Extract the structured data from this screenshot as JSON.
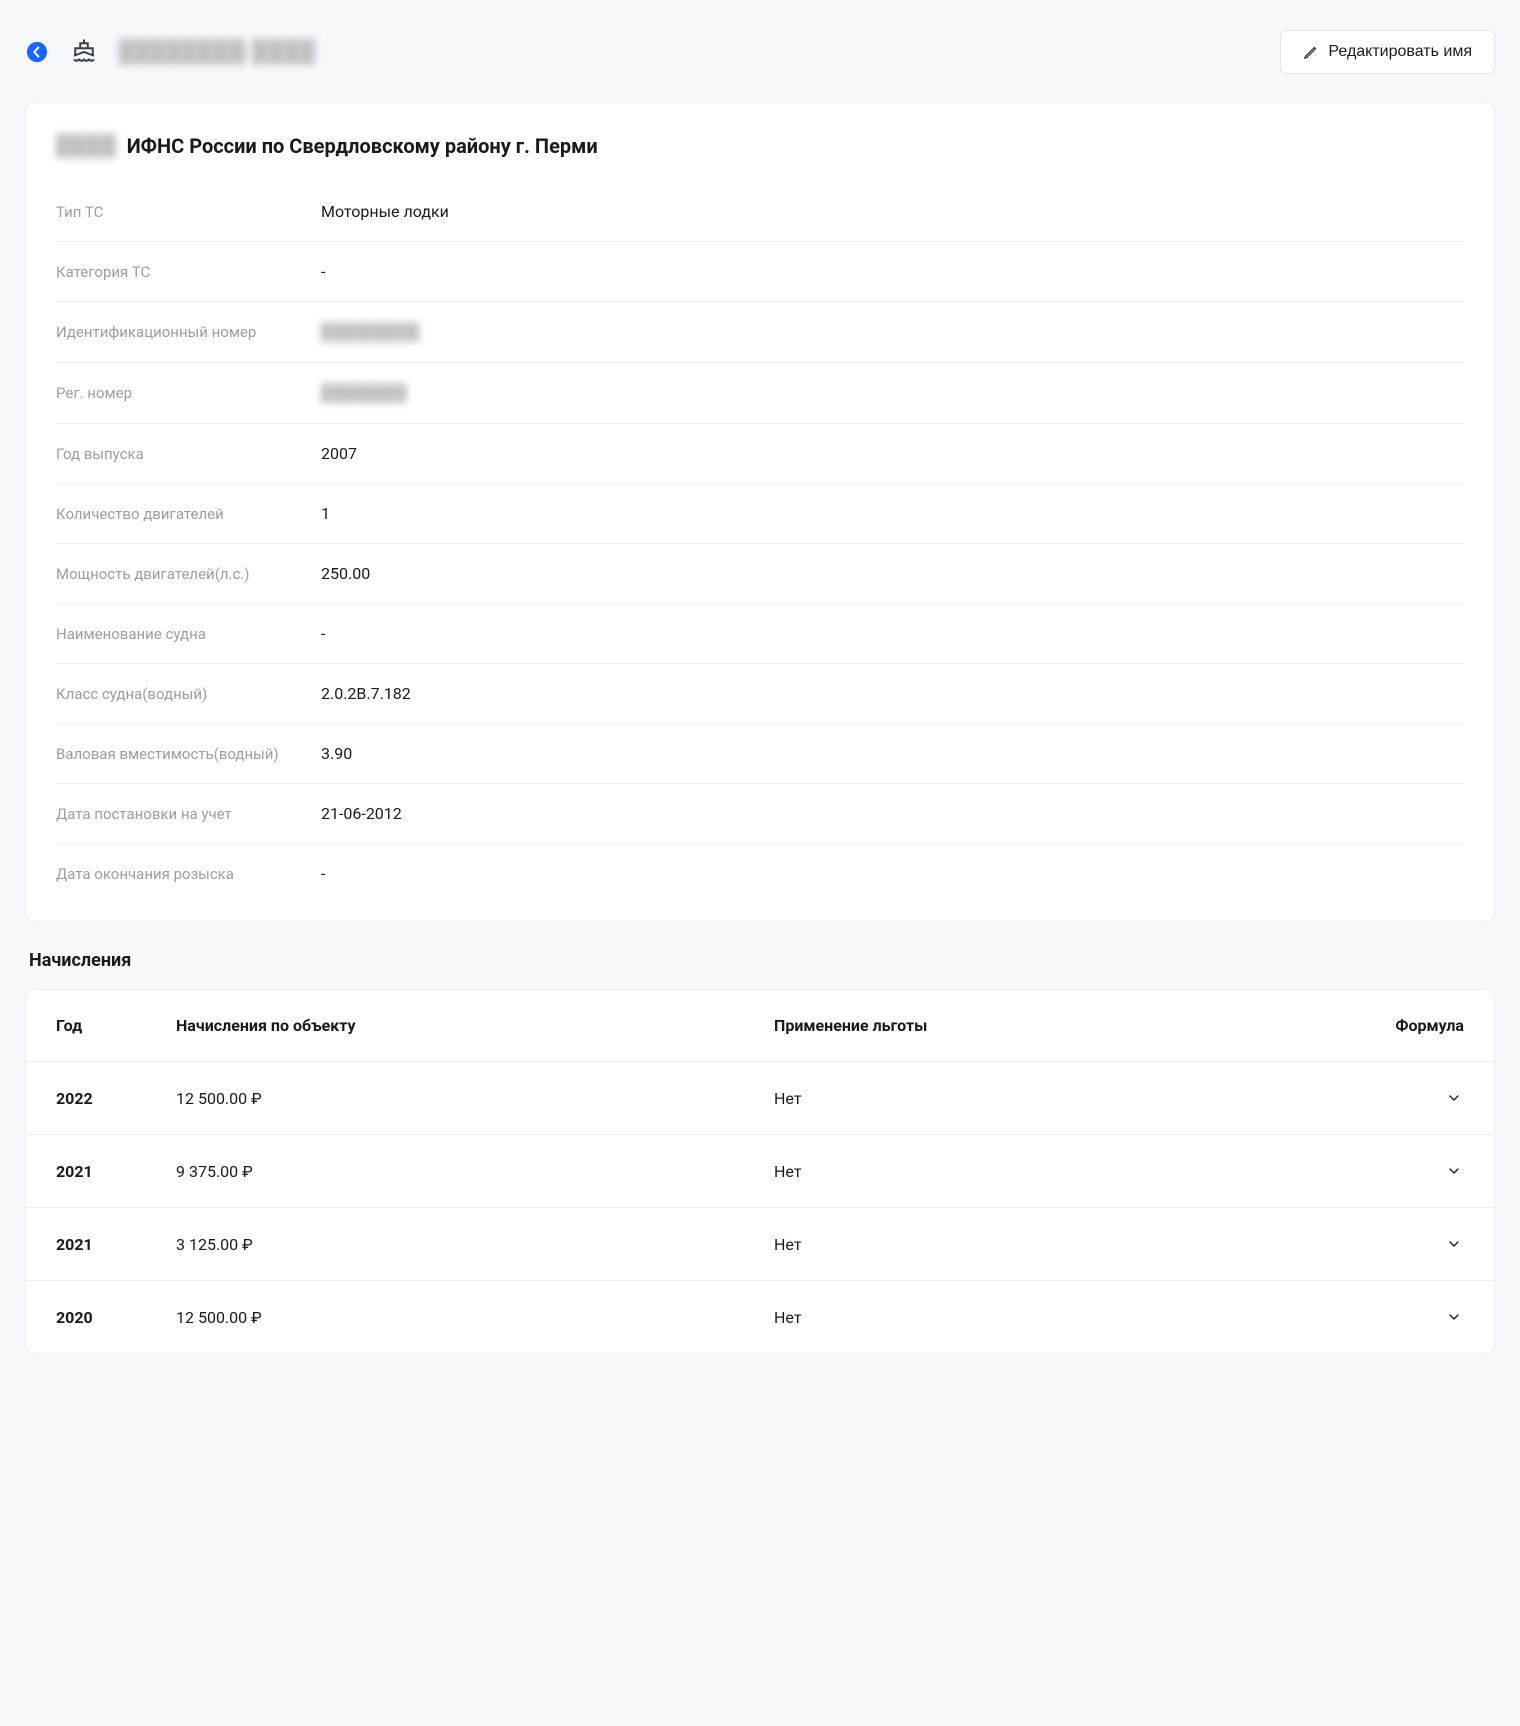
{
  "header": {
    "ship_title": "████████ ████",
    "edit_label": "Редактировать имя"
  },
  "card": {
    "id": "████",
    "title": "ИФНС России по Свердловскому району г. Перми"
  },
  "details": [
    {
      "label": "Тип ТС",
      "value": "Моторные лодки",
      "blurred": false
    },
    {
      "label": "Категория ТС",
      "value": "-",
      "blurred": false
    },
    {
      "label": "Идентификационный номер",
      "value": "████████",
      "blurred": true
    },
    {
      "label": "Рег. номер",
      "value": "███████",
      "blurred": true
    },
    {
      "label": "Год выпуска",
      "value": "2007",
      "blurred": false
    },
    {
      "label": "Количество двигателей",
      "value": "1",
      "blurred": false
    },
    {
      "label": "Мощность двигателей(л.с.)",
      "value": "250.00",
      "blurred": false
    },
    {
      "label": "Наименование судна",
      "value": "-",
      "blurred": false
    },
    {
      "label": "Класс судна(водный)",
      "value": "2.0.2В.7.182",
      "blurred": false
    },
    {
      "label": "Валовая вместимость(водный)",
      "value": "3.90",
      "blurred": false
    },
    {
      "label": "Дата постановки на учет",
      "value": "21-06-2012",
      "blurred": false
    },
    {
      "label": "Дата окончания розыска",
      "value": "-",
      "blurred": false
    }
  ],
  "accruals": {
    "heading": "Начисления",
    "columns": {
      "year": "Год",
      "amount": "Начисления по объекту",
      "benefit": "Применение льготы",
      "formula": "Формула"
    },
    "rows": [
      {
        "year": "2022",
        "amount": "12 500.00 ₽",
        "benefit": "Нет"
      },
      {
        "year": "2021",
        "amount": "9 375.00 ₽",
        "benefit": "Нет"
      },
      {
        "year": "2021",
        "amount": "3 125.00 ₽",
        "benefit": "Нет"
      },
      {
        "year": "2020",
        "amount": "12 500.00 ₽",
        "benefit": "Нет"
      }
    ]
  }
}
